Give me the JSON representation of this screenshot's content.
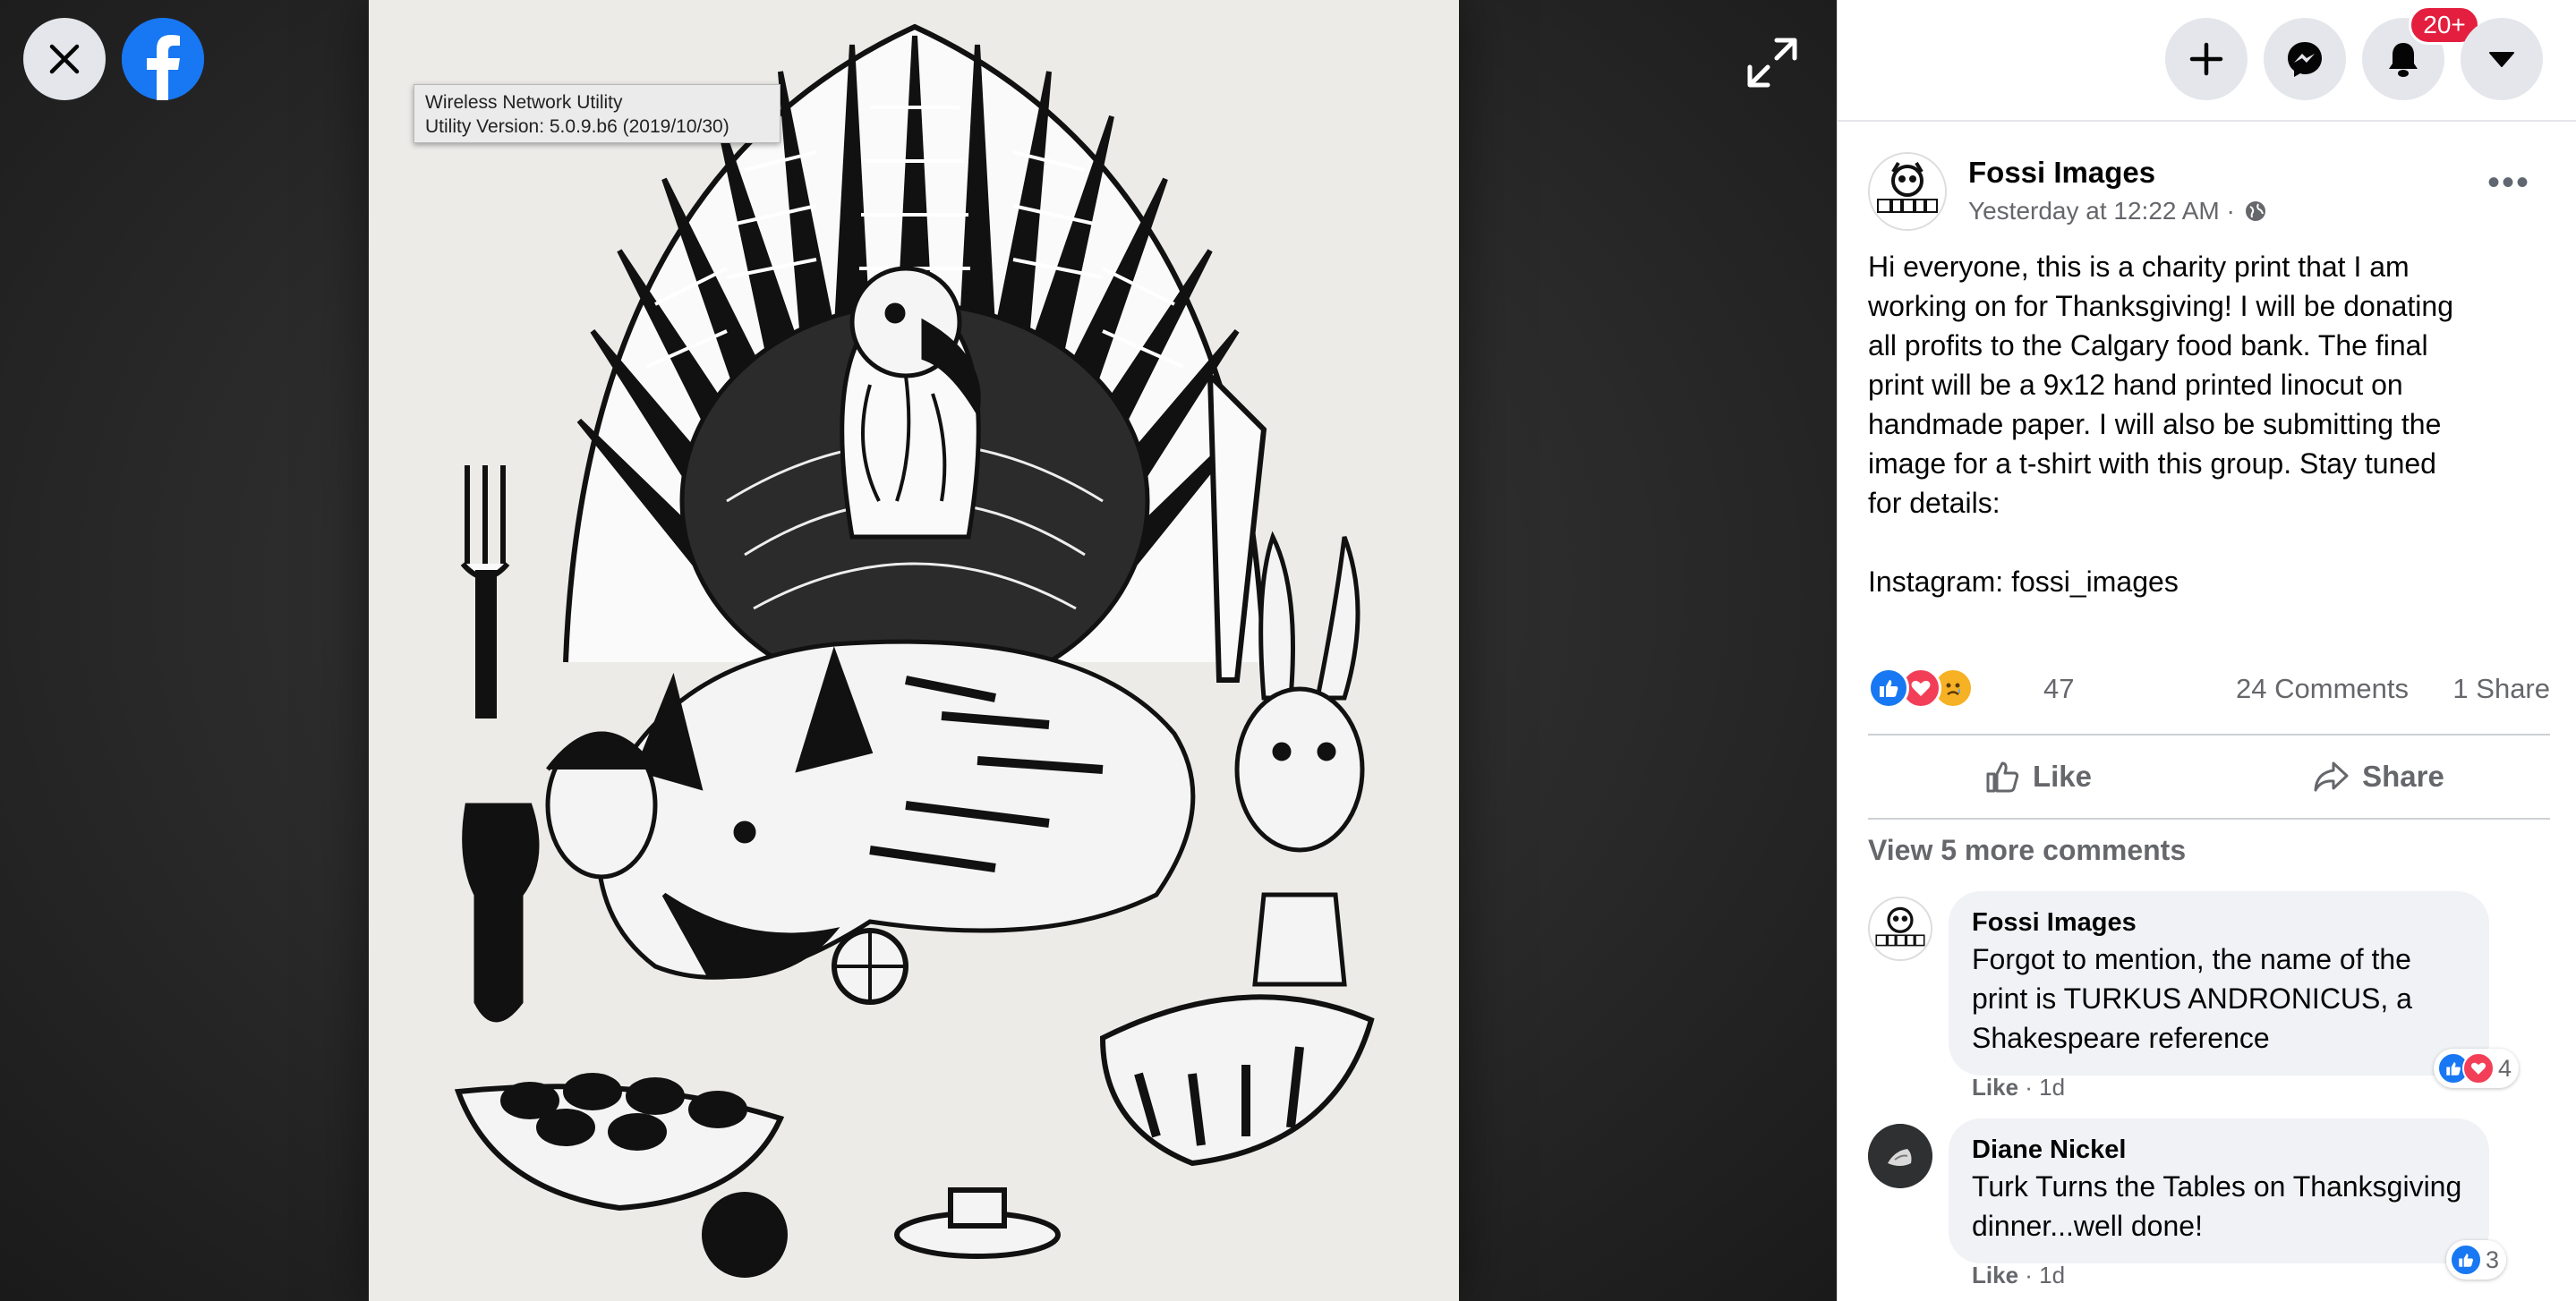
{
  "viewer": {
    "close_icon": "close-icon",
    "logo_icon": "facebook-logo-icon",
    "expand_icon": "expand-icon",
    "tooltip": {
      "line1": "Wireless Network Utility",
      "line2": "Utility Version: 5.0.9.b6 (2019/10/30)"
    }
  },
  "topbar": {
    "create_icon": "plus-icon",
    "messenger_icon": "messenger-icon",
    "notifications_icon": "bell-icon",
    "notifications_badge": "20+",
    "account_icon": "caret-down-icon"
  },
  "post": {
    "author": "Fossi Images",
    "time": "Yesterday at 12:22 AM ·",
    "privacy_icon": "globe-icon",
    "menu": "•••",
    "text": "Hi everyone, this is a charity print that I am\nworking on for Thanksgiving! I will be donating\nall profits to the Calgary food bank. The final\nprint will be a 9x12 hand printed linocut on\nhandmade paper. I will also be submitting the\nimage for a t-shirt with this group. Stay tuned\nfor details:\n\nInstagram: fossi_images",
    "reactions": {
      "icons": [
        "like-reaction-icon",
        "love-reaction-icon",
        "sad-reaction-icon"
      ],
      "count": "47",
      "comments": "24 Comments",
      "shares": "1 Share"
    },
    "actions": {
      "like": "Like",
      "share": "Share"
    },
    "view_more": "View 5 more comments"
  },
  "comments": [
    {
      "author": "Fossi Images",
      "text": "Forgot to mention, the name of the print is TURKUS ANDRONICUS, a Shakespeare reference",
      "like": "Like",
      "age": "· 1d",
      "reaction_count": "4"
    },
    {
      "author": "Diane Nickel",
      "text": "Turk Turns the Tables on Thanksgiving dinner...well done!",
      "like": "Like",
      "age": "· 1d",
      "reaction_count": "3"
    }
  ],
  "colors": {
    "brand": "#1877f2",
    "badge": "#e41e3f",
    "secondary_text": "#65676b",
    "bubble": "#f0f2f5"
  }
}
